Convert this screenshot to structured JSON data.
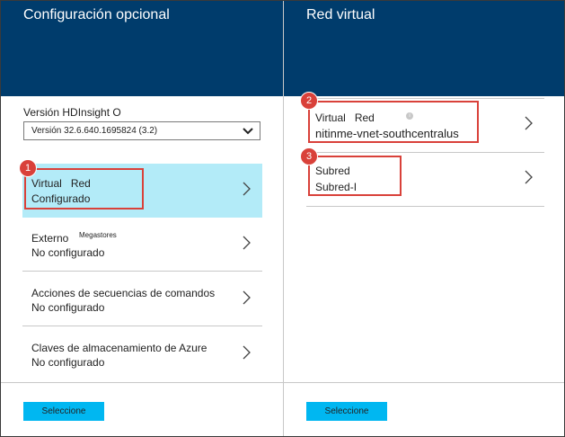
{
  "left_blade": {
    "title": "Configuración opcional",
    "version_label": "Versión HDInsight O",
    "version_value": "Versión 32.6.640.1695824 (3.2)",
    "items": [
      {
        "title": "Virtual",
        "title2": "Red",
        "subtitle": "Configurado",
        "badge": "1"
      },
      {
        "title": "Externo",
        "tag": "Megastores",
        "subtitle": "No configurado"
      },
      {
        "title": "Acciones de secuencias de comandos",
        "subtitle": "No configurado"
      },
      {
        "title": "Claves de almacenamiento de Azure",
        "subtitle": "No configurado"
      }
    ],
    "button_label": "Seleccione"
  },
  "right_blade": {
    "title": "Red virtual",
    "items": [
      {
        "title": "Virtual",
        "title2": "Red",
        "subtitle": "nitinme-vnet-southcentralus",
        "badge": "2"
      },
      {
        "title": "Subred",
        "subtitle": "Subred-I",
        "badge": "3"
      }
    ],
    "button_label": "Seleccione"
  },
  "colors": {
    "header": "#003c6c",
    "selected": "#b3ebf8",
    "button": "#00b7f1",
    "callout": "#d9413a"
  }
}
